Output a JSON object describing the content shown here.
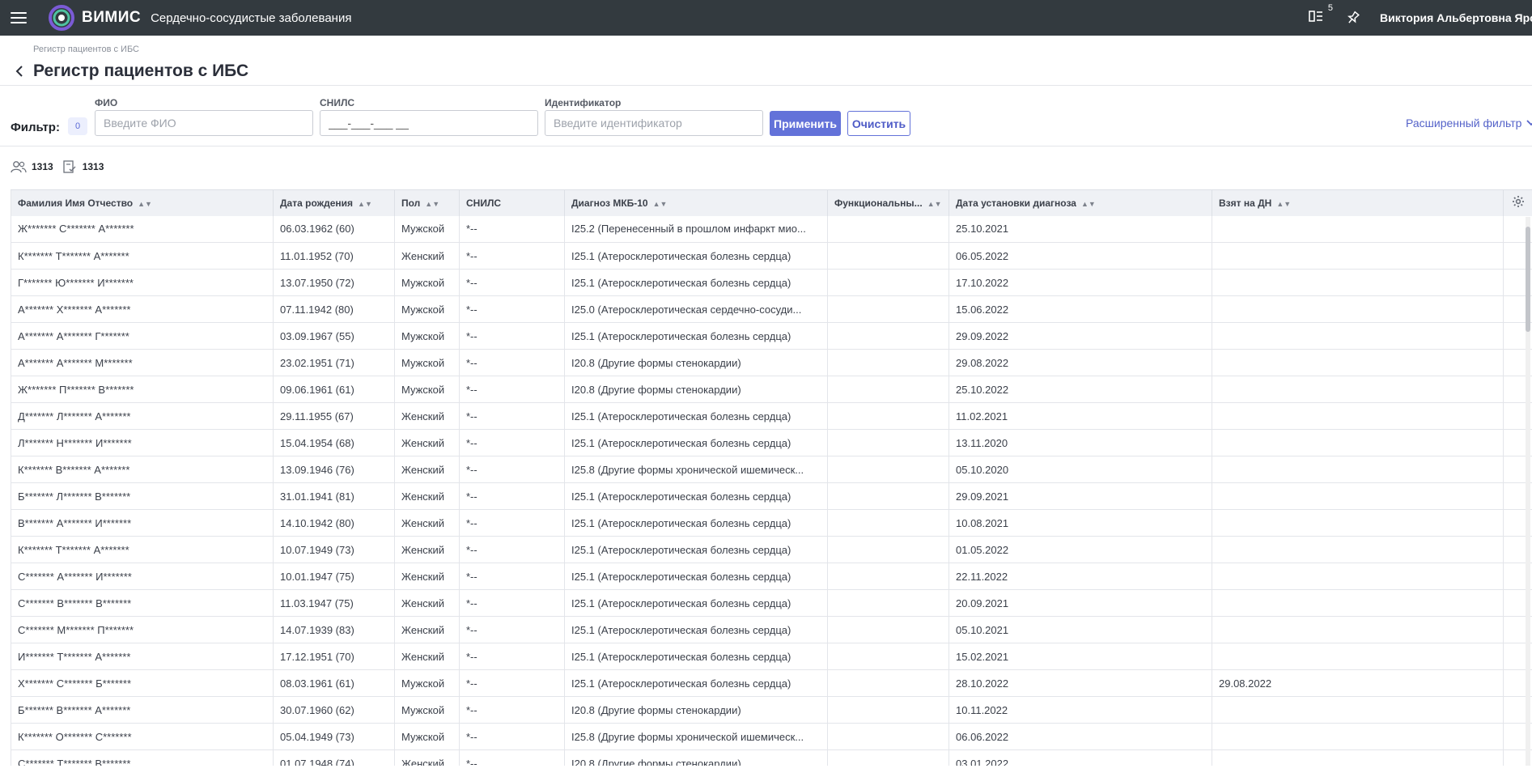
{
  "app": {
    "brand": "ВИМИС",
    "subtitle": "Сердечно-сосудистые заболевания",
    "notification_count": "5",
    "user_name": "Виктория Альбертовна Ярова"
  },
  "breadcrumb": "Регистр пациентов с ИБС",
  "page_title": "Регистр пациентов с ИБС",
  "filter": {
    "label": "Фильтр:",
    "count": "0",
    "fio_label": "ФИО",
    "fio_placeholder": "Введите ФИО",
    "snils_label": "СНИЛС",
    "snils_value": "___-___-___ __",
    "id_label": "Идентификатор",
    "id_placeholder": "Введите идентификатор",
    "apply_label": "Применить",
    "clear_label": "Очистить",
    "advanced_label": "Расширенный фильтр"
  },
  "stats": {
    "patients": "1313",
    "records": "1313"
  },
  "table": {
    "columns": [
      "Фамилия Имя Отчество",
      "Дата рождения",
      "Пол",
      "СНИЛС",
      "Диагноз МКБ-10",
      "Функциональны...",
      "Дата установки диагноза",
      "Взят на ДН"
    ],
    "rows": [
      [
        "Ж******* С******* А*******",
        "06.03.1962 (60)",
        "Мужской",
        "*--",
        "I25.2 (Перенесенный в прошлом инфаркт мио...",
        "",
        "25.10.2021",
        ""
      ],
      [
        "К******* Т******* А*******",
        "11.01.1952 (70)",
        "Женский",
        "*--",
        "I25.1 (Атеросклеротическая болезнь сердца)",
        "",
        "06.05.2022",
        ""
      ],
      [
        "Г******* Ю******* И*******",
        "13.07.1950 (72)",
        "Мужской",
        "*--",
        "I25.1 (Атеросклеротическая болезнь сердца)",
        "",
        "17.10.2022",
        ""
      ],
      [
        "А******* Х******* А*******",
        "07.11.1942 (80)",
        "Мужской",
        "*--",
        "I25.0 (Атеросклеротическая сердечно-сосуди...",
        "",
        "15.06.2022",
        ""
      ],
      [
        "А******* А******* Г*******",
        "03.09.1967 (55)",
        "Мужской",
        "*--",
        "I25.1 (Атеросклеротическая болезнь сердца)",
        "",
        "29.09.2022",
        ""
      ],
      [
        "А******* А******* М*******",
        "23.02.1951 (71)",
        "Мужской",
        "*--",
        "I20.8 (Другие формы стенокардии)",
        "",
        "29.08.2022",
        ""
      ],
      [
        "Ж******* П******* В*******",
        "09.06.1961 (61)",
        "Мужской",
        "*--",
        "I20.8 (Другие формы стенокардии)",
        "",
        "25.10.2022",
        ""
      ],
      [
        "Д******* Л******* А*******",
        "29.11.1955 (67)",
        "Женский",
        "*--",
        "I25.1 (Атеросклеротическая болезнь сердца)",
        "",
        "11.02.2021",
        ""
      ],
      [
        "Л******* Н******* И*******",
        "15.04.1954 (68)",
        "Женский",
        "*--",
        "I25.1 (Атеросклеротическая болезнь сердца)",
        "",
        "13.11.2020",
        ""
      ],
      [
        "К******* В******* А*******",
        "13.09.1946 (76)",
        "Женский",
        "*--",
        "I25.8 (Другие формы хронической ишемическ...",
        "",
        "05.10.2020",
        ""
      ],
      [
        "Б******* Л******* В*******",
        "31.01.1941 (81)",
        "Женский",
        "*--",
        "I25.1 (Атеросклеротическая болезнь сердца)",
        "",
        "29.09.2021",
        ""
      ],
      [
        "В******* А******* И*******",
        "14.10.1942 (80)",
        "Женский",
        "*--",
        "I25.1 (Атеросклеротическая болезнь сердца)",
        "",
        "10.08.2021",
        ""
      ],
      [
        "К******* Т******* А*******",
        "10.07.1949 (73)",
        "Женский",
        "*--",
        "I25.1 (Атеросклеротическая болезнь сердца)",
        "",
        "01.05.2022",
        ""
      ],
      [
        "С******* А******* И*******",
        "10.01.1947 (75)",
        "Женский",
        "*--",
        "I25.1 (Атеросклеротическая болезнь сердца)",
        "",
        "22.11.2022",
        ""
      ],
      [
        "С******* В******* В*******",
        "11.03.1947 (75)",
        "Женский",
        "*--",
        "I25.1 (Атеросклеротическая болезнь сердца)",
        "",
        "20.09.2021",
        ""
      ],
      [
        "С******* М******* П*******",
        "14.07.1939 (83)",
        "Женский",
        "*--",
        "I25.1 (Атеросклеротическая болезнь сердца)",
        "",
        "05.10.2021",
        ""
      ],
      [
        "И******* Т******* А*******",
        "17.12.1951 (70)",
        "Женский",
        "*--",
        "I25.1 (Атеросклеротическая болезнь сердца)",
        "",
        "15.02.2021",
        ""
      ],
      [
        "Х******* С******* Б*******",
        "08.03.1961 (61)",
        "Мужской",
        "*--",
        "I25.1 (Атеросклеротическая болезнь сердца)",
        "",
        "28.10.2022",
        "29.08.2022"
      ],
      [
        "Б******* В******* А*******",
        "30.07.1960 (62)",
        "Мужской",
        "*--",
        "I20.8 (Другие формы стенокардии)",
        "",
        "10.11.2022",
        ""
      ],
      [
        "К******* О******* С*******",
        "05.04.1949 (73)",
        "Мужской",
        "*--",
        "I25.8 (Другие формы хронической ишемическ...",
        "",
        "06.06.2022",
        ""
      ],
      [
        "С******* Т******* В*******",
        "01.07.1948 (74)",
        "Женский",
        "*--",
        "I20.8 (Другие формы стенокардии)",
        "",
        "03.01.2022",
        ""
      ]
    ]
  },
  "icons": {
    "menu": "menu-icon",
    "logo": "vimis-logo-icon",
    "notifications": "notifications-list-icon",
    "pin": "pin-icon",
    "back": "chevron-left-icon",
    "advanced": "chevron-down-icon",
    "patients": "users-icon",
    "records": "document-check-icon",
    "sort": "sort-icon",
    "settings": "gear-icon"
  },
  "colors": {
    "topbar": "#333a3f",
    "accent": "#6372d9"
  }
}
